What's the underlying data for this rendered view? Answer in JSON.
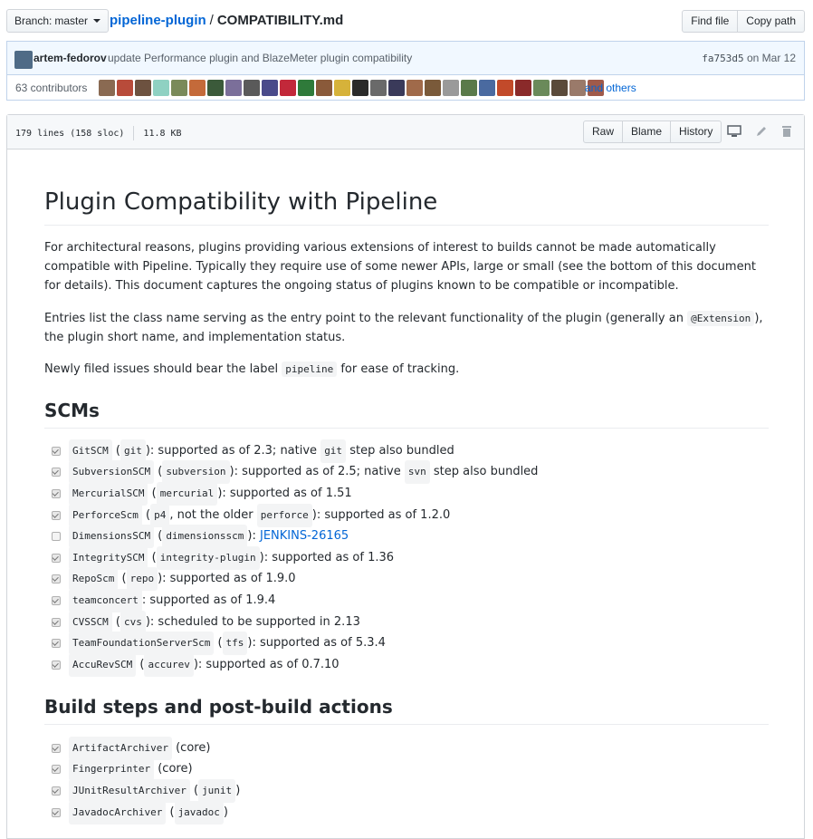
{
  "branch": {
    "label": "Branch:",
    "value": "master"
  },
  "breadcrumb": {
    "repo": "pipeline-plugin",
    "separator": "/",
    "file": "COMPATIBILITY.md"
  },
  "header_buttons": {
    "find_file": "Find file",
    "copy_path": "Copy path"
  },
  "commit": {
    "author": "artem-fedorov",
    "message": "update Performance plugin and BlazeMeter plugin compatibility",
    "sha": "fa753d5",
    "date": "on Mar 12"
  },
  "contributors": {
    "count_label": "63 contributors",
    "others_label": "and others",
    "avatar_colors": [
      "#8a6a52",
      "#b84b3a",
      "#6d5240",
      "#8fd1c2",
      "#7a8a5a",
      "#c46a3a",
      "#3b5a3a",
      "#7b6f9a",
      "#5a5a5a",
      "#4a4a8a",
      "#c2283a",
      "#2f7a3a",
      "#8a5a3a",
      "#d6b23a",
      "#2a2a2a",
      "#6a6a6a",
      "#3a3a5a",
      "#a06a4a",
      "#7a5a3a",
      "#9a9a9a",
      "#5a7a4a",
      "#4a6aa0",
      "#c24a2a",
      "#8a2a2a",
      "#6a8a5a",
      "#5a4a3a",
      "#9a7a6a",
      "#a05a4a"
    ]
  },
  "file": {
    "lines": "179 lines (158 sloc)",
    "size": "11.8 KB",
    "buttons": {
      "raw": "Raw",
      "blame": "Blame",
      "history": "History"
    },
    "icons": [
      "desktop-icon",
      "pencil-icon",
      "trash-icon"
    ]
  },
  "doc": {
    "title": "Plugin Compatibility with Pipeline",
    "intro": "For architectural reasons, plugins providing various extensions of interest to builds cannot be made automatically compatible with Pipeline. Typically they require use of some newer APIs, large or small (see the bottom of this document for details). This document captures the ongoing status of plugins known to be compatible or incompatible.",
    "entries_a": "Entries list the class name serving as the entry point to the relevant functionality of the plugin (generally an",
    "entries_code": "@Extension",
    "entries_b": "), the plugin short name, and implementation status.",
    "issues_a": "Newly filed issues should bear the label",
    "issues_code": "pipeline",
    "issues_b": "for ease of tracking.",
    "scm_heading": "SCMs",
    "scm_items": [
      {
        "checked": true,
        "parts": [
          [
            "c",
            "GitSCM"
          ],
          [
            "t",
            " ("
          ],
          [
            "c",
            "git"
          ],
          [
            "t",
            "): supported as of 2.3; native "
          ],
          [
            "c",
            "git"
          ],
          [
            "t",
            " step also bundled"
          ]
        ]
      },
      {
        "checked": true,
        "parts": [
          [
            "c",
            "SubversionSCM"
          ],
          [
            "t",
            " ("
          ],
          [
            "c",
            "subversion"
          ],
          [
            "t",
            "): supported as of 2.5; native "
          ],
          [
            "c",
            "svn"
          ],
          [
            "t",
            " step also bundled"
          ]
        ]
      },
      {
        "checked": true,
        "parts": [
          [
            "c",
            "MercurialSCM"
          ],
          [
            "t",
            " ("
          ],
          [
            "c",
            "mercurial"
          ],
          [
            "t",
            "): supported as of 1.51"
          ]
        ]
      },
      {
        "checked": true,
        "parts": [
          [
            "c",
            "PerforceScm"
          ],
          [
            "t",
            " ("
          ],
          [
            "c",
            "p4"
          ],
          [
            "t",
            ", not the older "
          ],
          [
            "c",
            "perforce"
          ],
          [
            "t",
            "): supported as of 1.2.0"
          ]
        ]
      },
      {
        "checked": false,
        "parts": [
          [
            "c",
            "DimensionsSCM"
          ],
          [
            "t",
            " ("
          ],
          [
            "c",
            "dimensionsscm"
          ],
          [
            "t",
            "): "
          ],
          [
            "l",
            "JENKINS-26165"
          ]
        ]
      },
      {
        "checked": true,
        "parts": [
          [
            "c",
            "IntegritySCM"
          ],
          [
            "t",
            " ("
          ],
          [
            "c",
            "integrity-plugin"
          ],
          [
            "t",
            "): supported as of 1.36"
          ]
        ]
      },
      {
        "checked": true,
        "parts": [
          [
            "c",
            "RepoScm"
          ],
          [
            "t",
            " ("
          ],
          [
            "c",
            "repo"
          ],
          [
            "t",
            "): supported as of 1.9.0"
          ]
        ]
      },
      {
        "checked": true,
        "parts": [
          [
            "c",
            "teamconcert"
          ],
          [
            "t",
            ": supported as of 1.9.4"
          ]
        ]
      },
      {
        "checked": true,
        "parts": [
          [
            "c",
            "CVSSCM"
          ],
          [
            "t",
            " ("
          ],
          [
            "c",
            "cvs"
          ],
          [
            "t",
            "): scheduled to be supported in 2.13"
          ]
        ]
      },
      {
        "checked": true,
        "parts": [
          [
            "c",
            "TeamFoundationServerScm"
          ],
          [
            "t",
            " ("
          ],
          [
            "c",
            "tfs"
          ],
          [
            "t",
            "): supported as of 5.3.4"
          ]
        ]
      },
      {
        "checked": true,
        "parts": [
          [
            "c",
            "AccuRevSCM"
          ],
          [
            "t",
            " ("
          ],
          [
            "c",
            "accurev"
          ],
          [
            "t",
            "): supported as of 0.7.10"
          ]
        ]
      }
    ],
    "build_heading": "Build steps and post-build actions",
    "build_items": [
      {
        "checked": true,
        "parts": [
          [
            "c",
            "ArtifactArchiver"
          ],
          [
            "t",
            " (core)"
          ]
        ]
      },
      {
        "checked": true,
        "parts": [
          [
            "c",
            "Fingerprinter"
          ],
          [
            "t",
            " (core)"
          ]
        ]
      },
      {
        "checked": true,
        "parts": [
          [
            "c",
            "JUnitResultArchiver"
          ],
          [
            "t",
            " ("
          ],
          [
            "c",
            "junit"
          ],
          [
            "t",
            ")"
          ]
        ]
      },
      {
        "checked": true,
        "parts": [
          [
            "c",
            "JavadocArchiver"
          ],
          [
            "t",
            " ("
          ],
          [
            "c",
            "javadoc"
          ],
          [
            "t",
            ")"
          ]
        ]
      }
    ]
  }
}
